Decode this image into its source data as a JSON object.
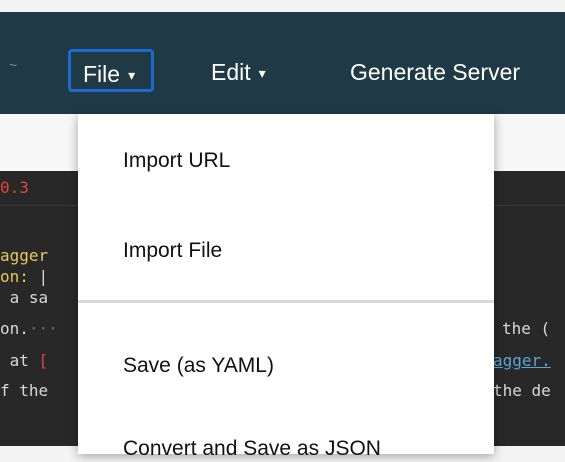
{
  "menubar": {
    "edge_fragment": "~",
    "file_label": "File",
    "edit_label": "Edit",
    "generate_label": "Generate Server",
    "caret": "▾"
  },
  "dropdown": {
    "items": [
      "Import URL",
      "Import File",
      "Save (as YAML)",
      "Convert and Save as JSON"
    ]
  },
  "editor": {
    "line1": "0.3",
    "line2": "agger",
    "line3a": "on:",
    "line3b": " |",
    "line4": " a sa",
    "line4_right": "the (",
    "line5a": "on.",
    "line5b": "···",
    "line6a": " at ",
    "line6b": "[",
    "line6_right": "agger.",
    "line7": "f the",
    "line7_right": "the de"
  }
}
